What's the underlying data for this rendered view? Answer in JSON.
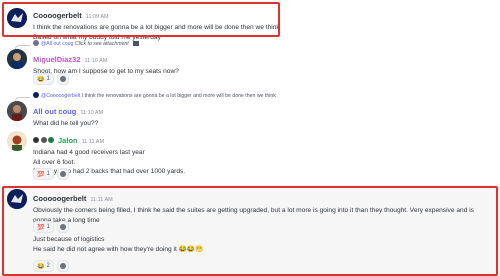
{
  "messages": [
    {
      "author": "Coooogerbelt",
      "author_color": "#2e3338",
      "time": "11:09 AM",
      "lines": [
        "I think the renovations are gonna be a lot bigger and more will be done then we think",
        "Based on what my buddy told me yesterday"
      ]
    },
    {
      "reply_to": "@All out coug",
      "reply_text": "Click to see attachment",
      "author": "MiguelDiaz32",
      "author_color": "#c355c7",
      "time": "11:10 AM",
      "lines": [
        "Shoot, how am I suppose to get to my seats now?"
      ],
      "reactions": [
        {
          "emoji": "😂",
          "count": "1"
        }
      ]
    },
    {
      "reply_to": "@Cooooogerbelt",
      "reply_text": "I think the renovations are gonna be a lot bigger and more will be done then we think",
      "author": "All out coug",
      "author_color": "#5865f2",
      "time": "11:10 AM",
      "lines": [
        "What did he tell you??"
      ]
    },
    {
      "author": "Jalon",
      "author_color": "#23a55a",
      "time": "11:11 AM",
      "lines": [
        "Indiana had 4 good receivers last year",
        "All over 6 foot.",
        "But they also had 2 backs that had over 1000 yards."
      ],
      "reactions": [
        {
          "emoji": "💯",
          "count": "1"
        }
      ]
    },
    {
      "author": "Cooooogerbelt",
      "author_color": "#2e3338",
      "time": "11:11 AM",
      "lines": [
        "Obviously the corners being filled, I think he said the suites are getting upgraded, but a lot more is going into it than they thought. Very expensive and is gonna take a long time"
      ],
      "reactions": [
        {
          "emoji": "💯",
          "count": "1"
        }
      ],
      "more_lines": [
        "Just because of logistics",
        "He said he did not agree with how they're doing it 😂😂😬"
      ],
      "bottom_reactions": [
        {
          "emoji": "😂",
          "count": "2"
        }
      ]
    }
  ],
  "colors": {
    "highlight": "#e03131",
    "add_reaction_icon": "smiley-plus-icon"
  }
}
